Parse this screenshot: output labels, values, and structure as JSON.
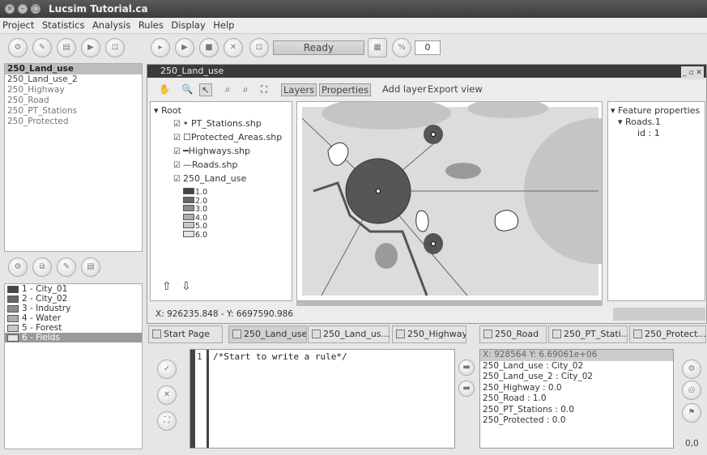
{
  "window": {
    "title": "Lucsim Tutorial.ca",
    "buttons": [
      "×",
      "–",
      "□"
    ]
  },
  "menu": [
    "Project",
    "Statistics",
    "Analysis",
    "Rules",
    "Display",
    "Help"
  ],
  "toolbar": {
    "status": "Ready",
    "counter": "0"
  },
  "layers_list": [
    {
      "label": "250_Land_use",
      "selected": true
    },
    {
      "label": "250_Land_use_2",
      "selected": false
    },
    {
      "label": "250_Highway",
      "selected": false
    },
    {
      "label": "250_Road",
      "selected": false
    },
    {
      "label": "250_PT_Stations",
      "selected": false
    },
    {
      "label": "250_Protected",
      "selected": false
    }
  ],
  "legend": [
    {
      "label": "1 - City_01",
      "color": "#454545"
    },
    {
      "label": "2 - City_02",
      "color": "#666666"
    },
    {
      "label": "3 - Industry",
      "color": "#8c8c8c"
    },
    {
      "label": "4 - Water",
      "color": "#adadad"
    },
    {
      "label": "5 - Forest",
      "color": "#c8c8c8"
    },
    {
      "label": "6 - Fields",
      "color": "#e6e6e6",
      "selected": true
    }
  ],
  "map_window": {
    "title": "250_Land_use",
    "toolbar": {
      "layers": "Layers",
      "properties": "Properties",
      "add_layer": "Add layer",
      "export_view": "Export view"
    },
    "tree": {
      "root": "Root",
      "items": [
        {
          "label": "PT_Stations.shp",
          "symbol": "•"
        },
        {
          "label": "Protected_Areas.shp",
          "symbol": "☐"
        },
        {
          "label": "Highways.shp",
          "symbol": "━"
        },
        {
          "label": "Roads.shp",
          "symbol": "—"
        },
        {
          "label": "250_Land_use",
          "symbol": ""
        }
      ],
      "classes": [
        {
          "label": "1.0",
          "color": "#454545"
        },
        {
          "label": "2.0",
          "color": "#666666"
        },
        {
          "label": "3.0",
          "color": "#8c8c8c"
        },
        {
          "label": "4.0",
          "color": "#adadad"
        },
        {
          "label": "5.0",
          "color": "#c8c8c8"
        },
        {
          "label": "6.0",
          "color": "#e6e6e6"
        }
      ]
    },
    "coords": "X: 926235.848 - Y: 6697590.986",
    "feature": {
      "title": "Feature properties",
      "item": "Roads.1",
      "attr": "id : 1"
    }
  },
  "tabs": [
    "Start Page",
    "250_Land_use",
    "250_Land_us...",
    "250_Highway",
    "250_Road",
    "250_PT_Stati...",
    "250_Protect..."
  ],
  "editor": {
    "line_no": "1",
    "code": "/*Start to write a rule*/"
  },
  "info": {
    "header": "X: 928564 Y: 6.69061e+06",
    "rows": [
      "250_Land_use : City_02",
      "250_Land_use_2 : City_02",
      "250_Highway : 0.0",
      "250_Road : 1.0",
      "250_PT_Stations : 0.0",
      "250_Protected : 0.0"
    ]
  },
  "corner_value": "0,0"
}
